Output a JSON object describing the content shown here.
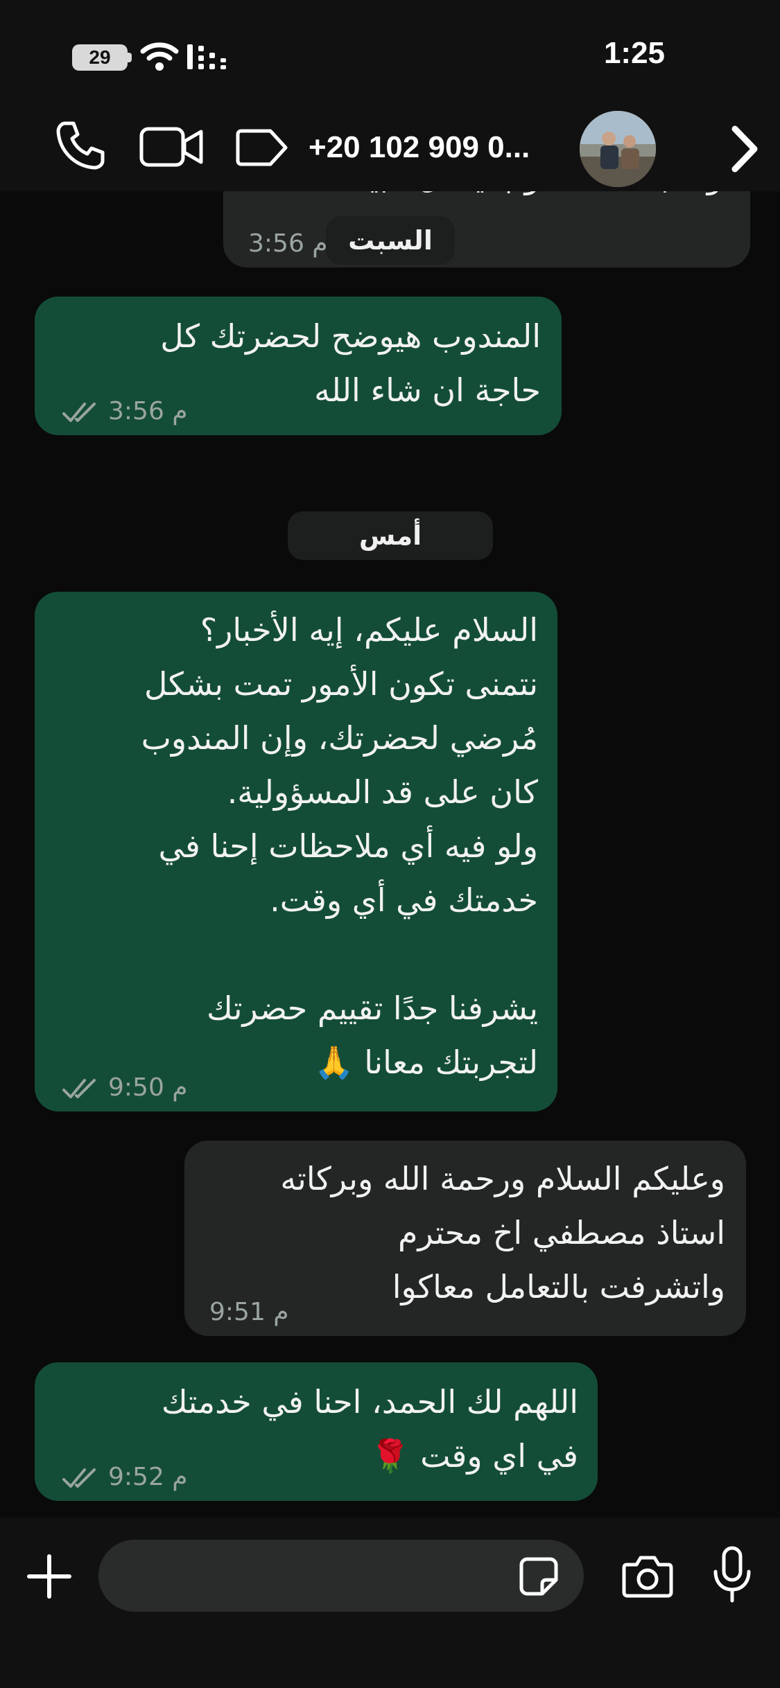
{
  "status_bar": {
    "battery_level": "29",
    "time": "1:25",
    "icons": [
      "battery-icon",
      "wifi-icon",
      "signal-icon"
    ]
  },
  "header": {
    "contact_name": "+20 102 909 0...",
    "icons": [
      "phone-icon",
      "video-call-icon",
      "label-icon",
      "chevron-right-icon"
    ]
  },
  "chat": {
    "partial_message": {
      "text": "ولا تبعت المندوب يعمل تثبيت",
      "time": "3:56 م"
    },
    "date_chip_saturday": "السبت",
    "date_chip_yesterday": "أمس",
    "messages": [
      {
        "direction": "out",
        "text": "المندوب هيوضح لحضرتك كل\nحاجة ان شاء الله",
        "time": "3:56 م"
      },
      {
        "direction": "out",
        "text": "السلام عليكم، إيه الأخبار؟\nنتمنى تكون الأمور تمت بشكل\nمُرضي لحضرتك، وإن المندوب\nكان على قد المسؤولية.\nولو فيه أي ملاحظات إحنا في\nخدمتك في أي وقت.\n\nيشرفنا جدًا تقييم حضرتك\nلتجربتك معانا 🙏",
        "time": "9:50 م"
      },
      {
        "direction": "in",
        "text": "وعليكم السلام ورحمة الله وبركاته\nاستاذ مصطفي اخ محترم\nواتشرفت بالتعامل معاكوا",
        "time": "9:51 م"
      },
      {
        "direction": "out",
        "text": "اللهم لك الحمد، احنا في خدمتك\nفي اي وقت 🌹",
        "time": "9:52 م"
      }
    ]
  },
  "composer": {
    "icons": [
      "plus-icon",
      "sticker-icon",
      "camera-icon",
      "microphone-icon"
    ]
  },
  "colors": {
    "outgoing_bubble": "#144d37",
    "incoming_bubble": "#242626",
    "background": "#0a0a0a",
    "bar_background": "#111111"
  }
}
